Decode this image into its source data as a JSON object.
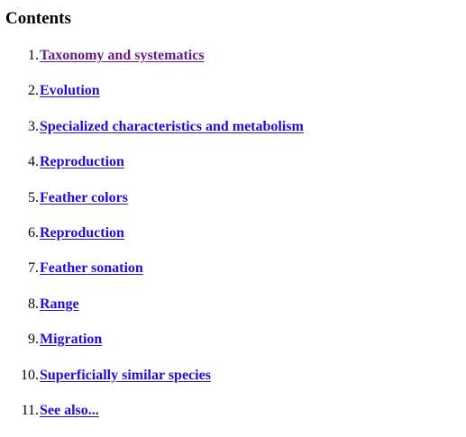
{
  "contents": {
    "title": "Contents",
    "colors": {
      "link": "#1f0ed6",
      "visited_link": "#681a88"
    },
    "items": [
      {
        "number": "1.",
        "label": "Taxonomy and systematics",
        "visited": true
      },
      {
        "number": "2.",
        "label": "Evolution",
        "visited": false
      },
      {
        "number": "3.",
        "label": "Specialized characteristics and metabolism",
        "visited": false
      },
      {
        "number": "4.",
        "label": "Reproduction",
        "visited": false
      },
      {
        "number": "5.",
        "label": "Feather colors",
        "visited": false
      },
      {
        "number": "6.",
        "label": "Reproduction",
        "visited": false
      },
      {
        "number": "7.",
        "label": "Feather sonation",
        "visited": false
      },
      {
        "number": "8.",
        "label": "Range",
        "visited": false
      },
      {
        "number": "9.",
        "label": "Migration",
        "visited": false
      },
      {
        "number": "10.",
        "label": "Superficially similar species",
        "visited": false
      },
      {
        "number": "11.",
        "label": "See also...",
        "visited": false
      }
    ]
  }
}
